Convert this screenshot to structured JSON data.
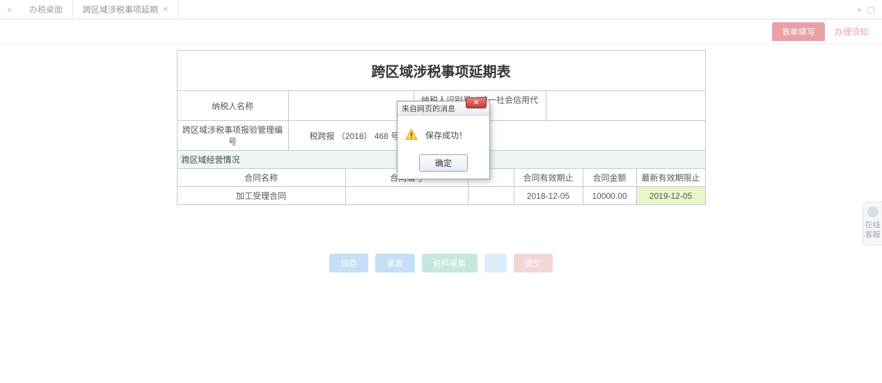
{
  "tabs": {
    "desk_label": "办税桌面",
    "current_label": "跨区域涉税事项延期"
  },
  "subtabs": {
    "fill_form": "表单填写",
    "guide": "办理须知"
  },
  "form": {
    "title": "跨区域涉税事项延期表",
    "taxpayer_name_label": "纳税人名称",
    "taxpayer_name_value": "",
    "taxpayer_id_label": "纳税人识别号（统一社会信用代码）",
    "taxpayer_id_value": "",
    "doc_no_label": "跨区域涉税事项报验管理编号",
    "doc_no_value": "税跨报 （2018） 468 号",
    "section_label": "跨区域经营情况",
    "headers": {
      "contract_name": "合同名称",
      "contract_no": "合同编号",
      "valid_until": "合同有效期止",
      "amount": "合同金额",
      "new_valid_until": "最新有效期限止"
    },
    "row": {
      "contract_name": "加工受理合同",
      "contract_no": "",
      "valid_until": "2018-12-05",
      "amount": "10000.00",
      "new_valid_until": "2019-12-05"
    }
  },
  "actions": {
    "save": "保存",
    "reset": "重置",
    "attachments": "资料采集",
    "submit": "提交"
  },
  "dialog": {
    "title": "来自网页的消息",
    "message": "保存成功！",
    "ok": "确定"
  },
  "side_help": "在线客服"
}
